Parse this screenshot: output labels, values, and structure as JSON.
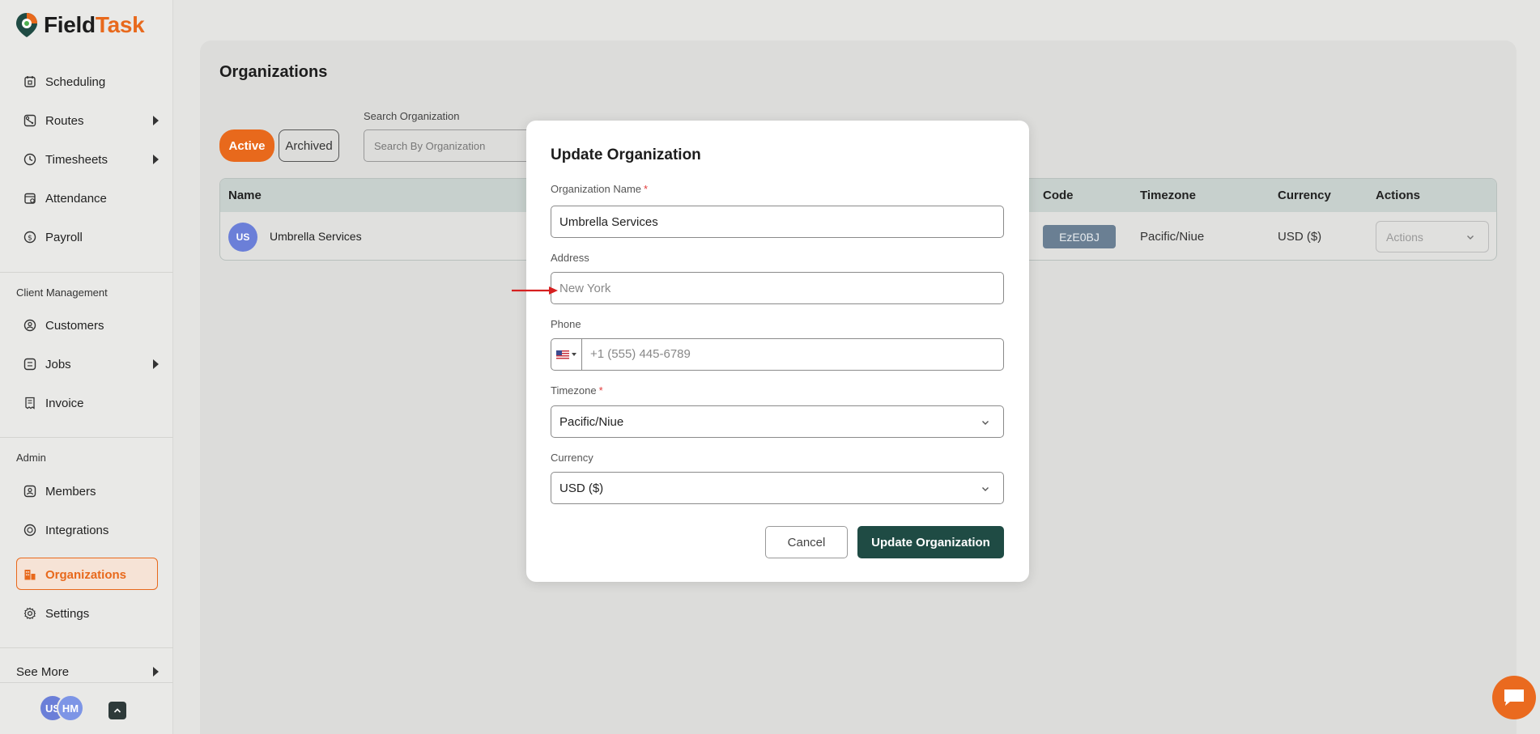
{
  "brand": {
    "logo_part1": "Field",
    "logo_part2": "Task",
    "accent": "#e8691c",
    "primary_dark": "#1f4b44"
  },
  "sidebar": {
    "items": [
      {
        "label": "Scheduling",
        "icon": "calendar-icon",
        "expandable": false
      },
      {
        "label": "Routes",
        "icon": "route-icon",
        "expandable": true
      },
      {
        "label": "Timesheets",
        "icon": "clock-icon",
        "expandable": true
      },
      {
        "label": "Attendance",
        "icon": "attendance-icon",
        "expandable": false
      },
      {
        "label": "Payroll",
        "icon": "payroll-icon",
        "expandable": false
      }
    ],
    "client_section": "Client Management",
    "client_items": [
      {
        "label": "Customers",
        "icon": "customers-icon",
        "expandable": false
      },
      {
        "label": "Jobs",
        "icon": "jobs-icon",
        "expandable": true
      },
      {
        "label": "Invoice",
        "icon": "invoice-icon",
        "expandable": false
      }
    ],
    "admin_section": "Admin",
    "admin_items": [
      {
        "label": "Members",
        "icon": "members-icon",
        "expandable": false
      },
      {
        "label": "Integrations",
        "icon": "integrations-icon",
        "expandable": false
      },
      {
        "label": "Organizations",
        "icon": "organizations-icon",
        "active": true
      },
      {
        "label": "Settings",
        "icon": "gear-icon",
        "expandable": false
      }
    ],
    "see_more": "See More",
    "user_avatars": [
      "US",
      "HM"
    ]
  },
  "page": {
    "title": "Organizations",
    "tabs": {
      "active": "Active",
      "archived": "Archived"
    },
    "search": {
      "label": "Search Organization",
      "placeholder": "Search By Organization"
    }
  },
  "table": {
    "columns": {
      "name": "Name",
      "code": "Code",
      "timezone": "Timezone",
      "currency": "Currency",
      "actions": "Actions"
    },
    "rows": [
      {
        "initials": "US",
        "name": "Umbrella Services",
        "code": "EzE0BJ",
        "timezone": "Pacific/Niue",
        "currency": "USD ($)",
        "actions": "Actions"
      }
    ]
  },
  "modal": {
    "title": "Update Organization",
    "org_name_label": "Organization Name",
    "org_name_value": "Umbrella Services",
    "address_label": "Address",
    "address_placeholder": "New York",
    "phone_label": "Phone",
    "phone_placeholder": "+1 (555) 445-6789",
    "timezone_label": "Timezone",
    "timezone_value": "Pacific/Niue",
    "currency_label": "Currency",
    "currency_value": "USD ($)",
    "cancel_label": "Cancel",
    "submit_label": "Update Organization"
  }
}
